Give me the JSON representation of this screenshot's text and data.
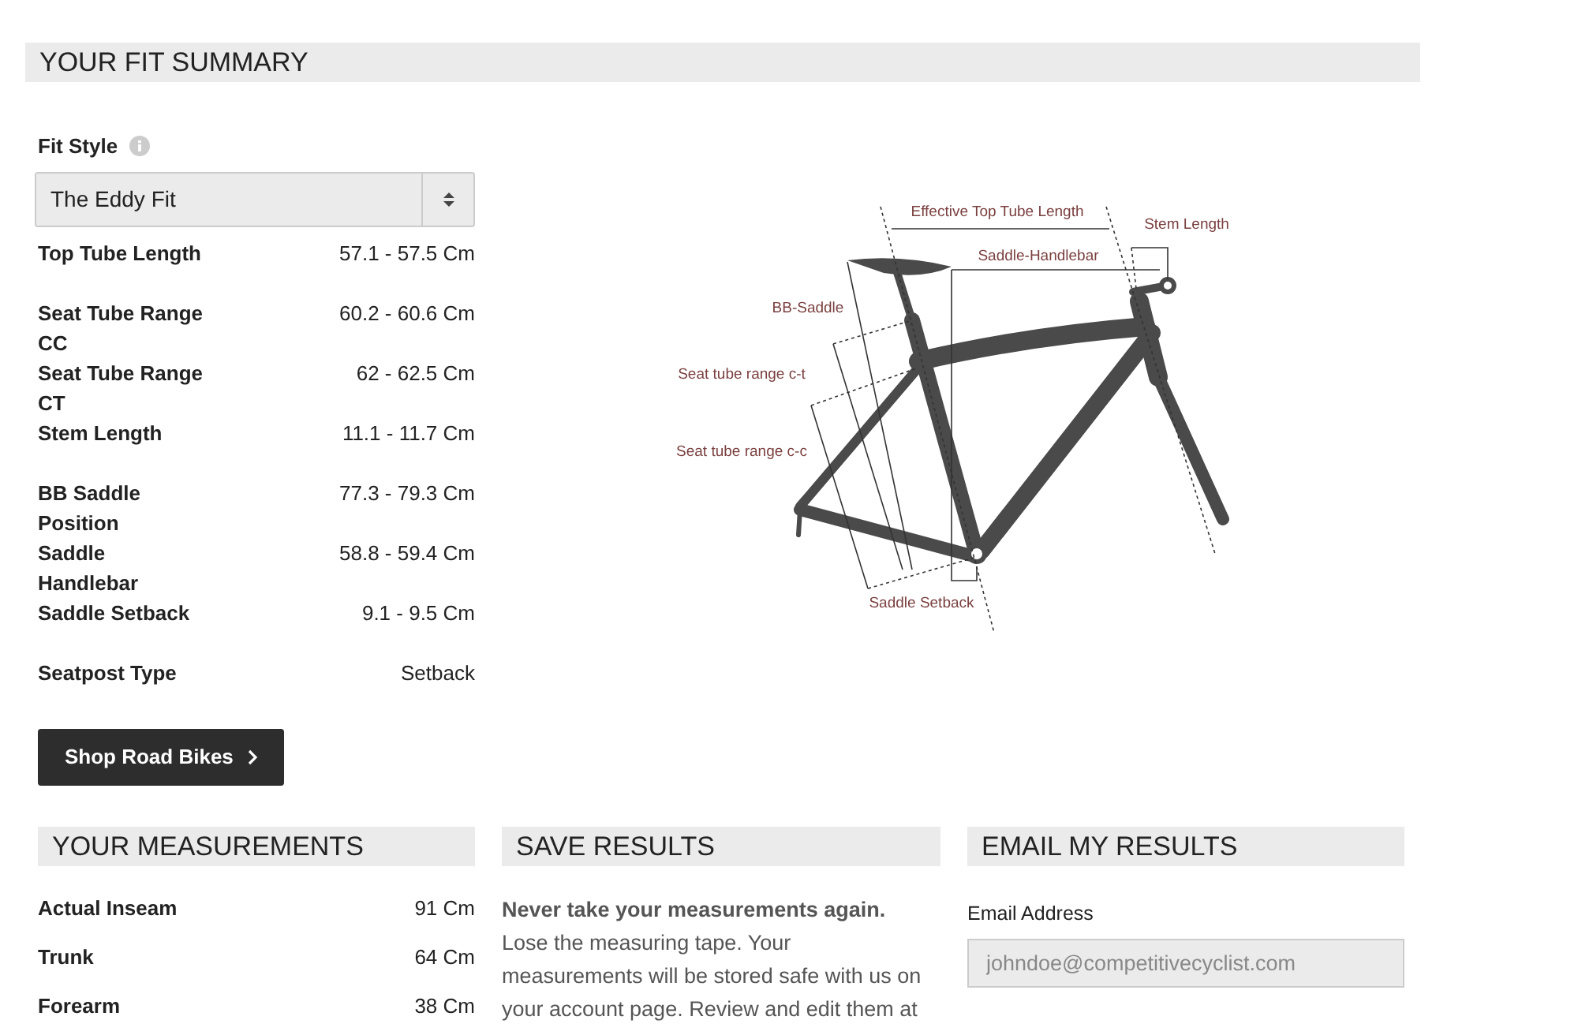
{
  "title": "YOUR FIT SUMMARY",
  "fit_style": {
    "label": "Fit Style",
    "value": "The Eddy Fit"
  },
  "fit_rows": [
    {
      "label": "Top Tube Length",
      "value": "57.1 - 57.5 Cm"
    },
    {
      "label": "Seat Tube Range CC",
      "value": "60.2 - 60.6 Cm"
    },
    {
      "label": "Seat Tube Range CT",
      "value": "62 - 62.5 Cm"
    },
    {
      "label": "Stem Length",
      "value": "11.1 - 11.7 Cm"
    },
    {
      "label": "BB Saddle Position",
      "value": "77.3 - 79.3 Cm"
    },
    {
      "label": "Saddle Handlebar",
      "value": "58.8 - 59.4 Cm"
    },
    {
      "label": "Saddle Setback",
      "value": "9.1 - 9.5 Cm"
    },
    {
      "label": "Seatpost Type",
      "value": "Setback"
    }
  ],
  "diagram": {
    "labels": [
      "Effective Top Tube Length",
      "Stem Length",
      "Saddle-Handlebar",
      "BB-Saddle",
      "Seat tube range c-t",
      "Seat tube range c-c",
      "Saddle Setback"
    ]
  },
  "shop_button": "Shop Road Bikes",
  "measurements": {
    "title": "YOUR MEASUREMENTS",
    "rows": [
      {
        "label": "Actual Inseam",
        "value": "91 Cm"
      },
      {
        "label": "Trunk",
        "value": "64 Cm"
      },
      {
        "label": "Forearm",
        "value": "38 Cm"
      }
    ]
  },
  "save_results": {
    "title": "SAVE RESULTS",
    "lead": "Never take your measurements again.",
    "text": "Lose the measuring tape. Your measurements will be stored safe with us on your account page. Review and edit them at"
  },
  "email": {
    "title": "EMAIL MY RESULTS",
    "label": "Email Address",
    "placeholder": "johndoe@competitivecyclist.com"
  }
}
